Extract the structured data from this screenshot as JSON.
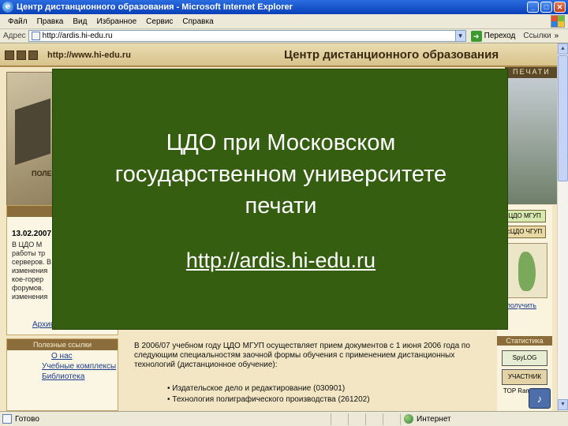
{
  "window": {
    "title": "Центр дистанционного образования - Microsoft Internet Explorer",
    "minimize": "_",
    "maximize": "□",
    "close": "✕"
  },
  "menu": [
    "Файл",
    "Правка",
    "Вид",
    "Избранное",
    "Сервис",
    "Справка"
  ],
  "address": {
    "label": "Адрес",
    "value": "http://ardis.hi-edu.ru",
    "go_label": "Переход",
    "links_label": "Ссылки",
    "chevron": "»"
  },
  "site": {
    "url": "http://www.hi-edu.ru",
    "title": "Центр дистанционного образования",
    "print_label": "ПЕЧАТИ",
    "banner_caption": "ПОЛЕ",
    "news_date": "13.02.2007",
    "news_lines": [
      "В ЦДО М",
      "работы тр",
      "серверов. В",
      "изменения",
      "кое-горер",
      "форумов.",
      "изменения"
    ],
    "news_more": "Архив",
    "useful_head": "Полезные ссылки",
    "useful_links": [
      "О нас",
      "Учебные комплексы",
      "Библиотека"
    ],
    "main_text": "В 2006/07 учебном году ЦДО МГУП осуществляет прием документов с 1 июня 2006 года по следующим специальностям заочной формы обучения с применением дистанционных технологий (дистанционное обучение):",
    "bullets": [
      "• Издательское дело и редактирование (030901)",
      "• Технология полиграфического производства (261202)"
    ],
    "right_logo": "ЦДО МГУП",
    "right_logo2": "сЦДО ЧГУП",
    "right_link": "получить",
    "stat_head": "Статистика",
    "badge1": "SpyLOG",
    "badge2": "УЧАСТНИК TOP Rambler's"
  },
  "overlay": {
    "title_lines": [
      "ЦДО при Московском",
      "государственном университете",
      "печати"
    ],
    "link": "http://ardis.hi-edu.ru"
  },
  "status": {
    "text": "Готово",
    "zone": "Интернет"
  },
  "colors": {
    "overlay_bg": "#355e11",
    "title_bar": "#0a3fb8",
    "site_bg": "#f2e6c4"
  }
}
